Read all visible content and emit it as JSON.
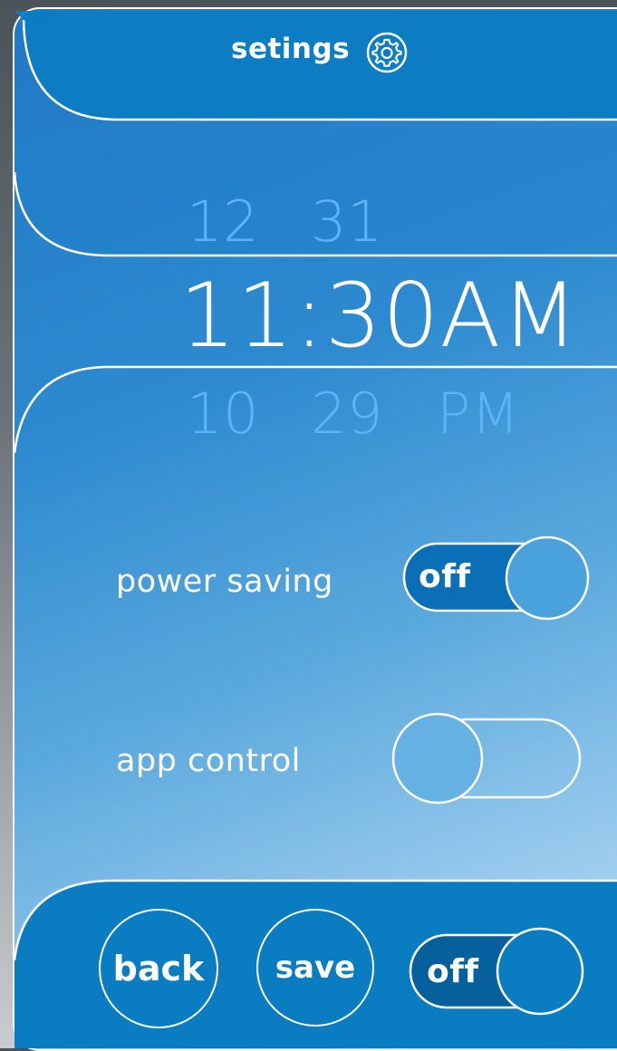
{
  "header": {
    "title": "setings",
    "icon": "gear-icon"
  },
  "time_picker": {
    "prev_row": {
      "hour": "12",
      "minute": "31"
    },
    "current": "11:30AM",
    "next_row": {
      "hour": "10",
      "minute": "29",
      "ampm": "PM"
    }
  },
  "settings": {
    "power_saving": {
      "label": "power saving",
      "toggle_label": "off",
      "state": "off"
    },
    "app_control": {
      "label": "app control",
      "state": "off"
    }
  },
  "footer": {
    "back_label": "back",
    "save_label": "save",
    "toggle_label": "off"
  },
  "colors": {
    "primary": "#0a7cc2",
    "dark": "#07609e",
    "ghost_text": "#5bb4f7",
    "white": "#ffffff"
  }
}
